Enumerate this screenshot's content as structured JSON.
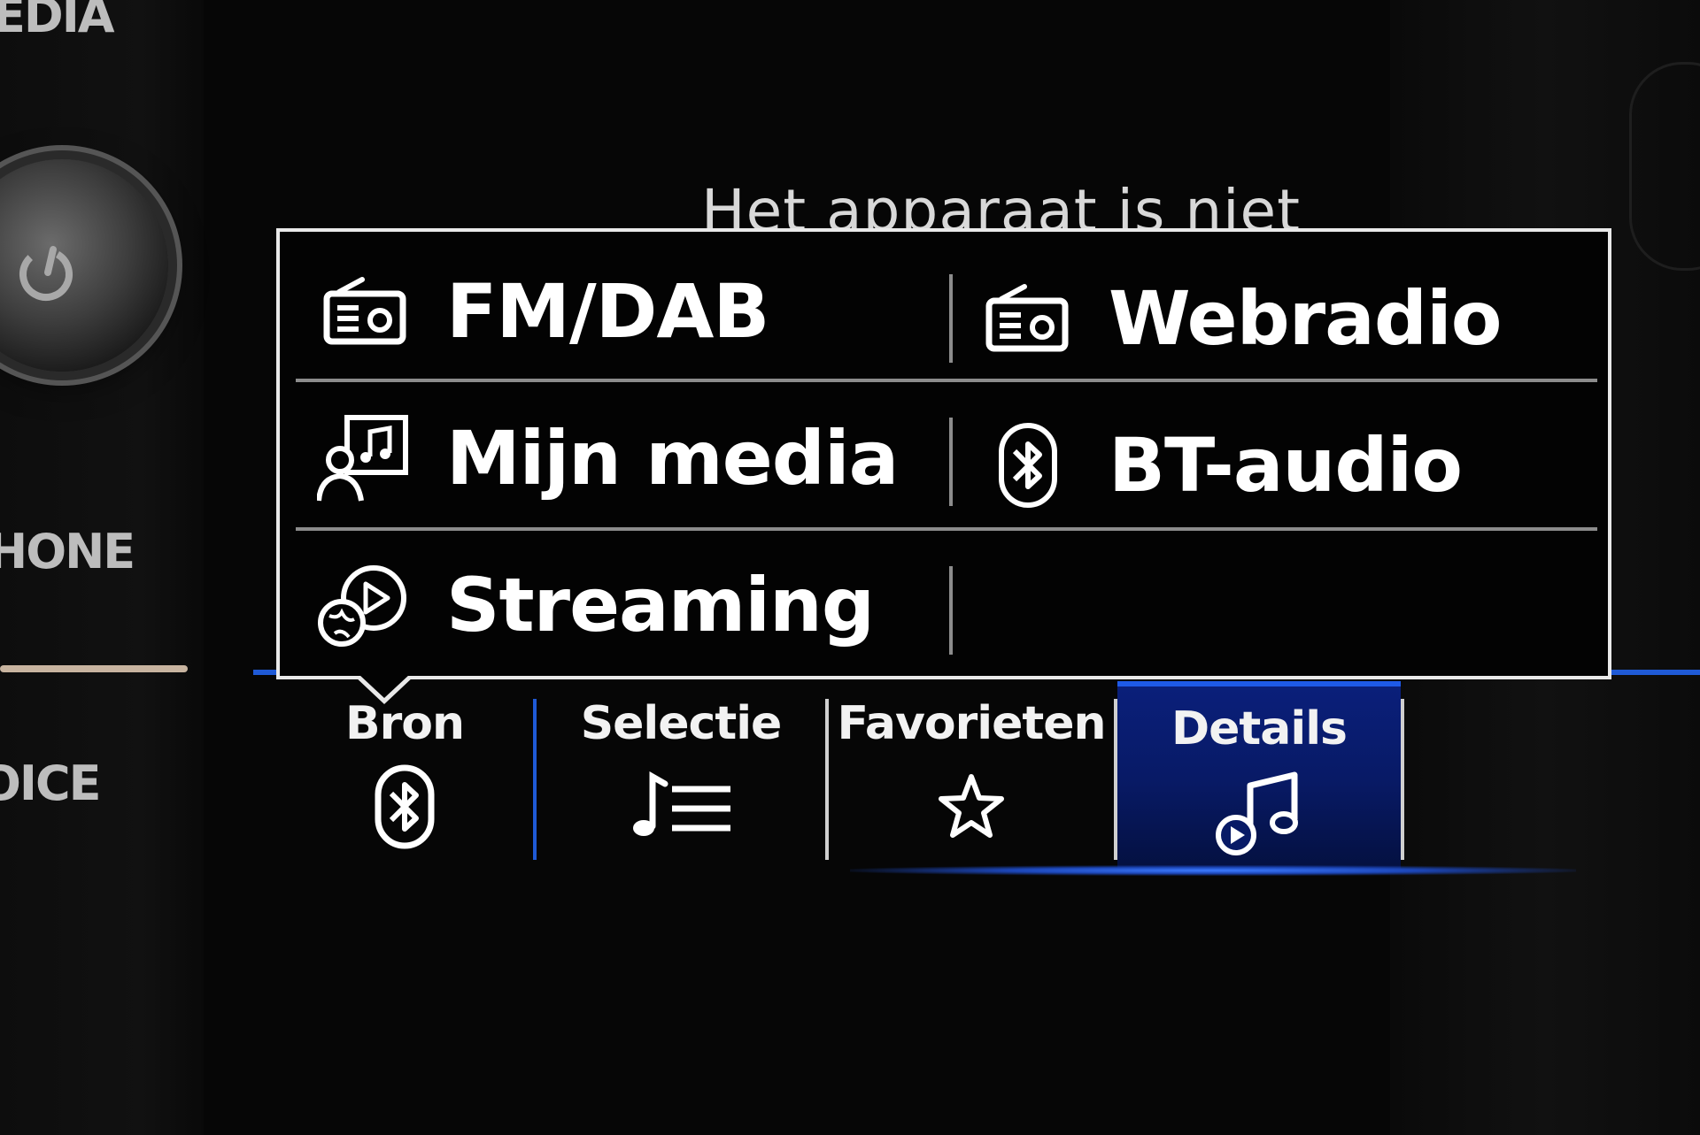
{
  "bezel": {
    "labels": {
      "media": "EDIA",
      "phone": "HONE",
      "voice": "OICE"
    }
  },
  "background_message": "Het apparaat is niet",
  "source_menu": {
    "items": [
      {
        "label": "FM/DAB",
        "icon": "radio-icon"
      },
      {
        "label": "Webradio",
        "icon": "radio-icon"
      },
      {
        "label": "Mijn media",
        "icon": "user-music-icon"
      },
      {
        "label": "BT-audio",
        "icon": "bluetooth-icon"
      },
      {
        "label": "Streaming",
        "icon": "streaming-icon"
      }
    ]
  },
  "tabs": [
    {
      "label": "Bron",
      "icon": "bluetooth-icon",
      "active": false
    },
    {
      "label": "Selectie",
      "icon": "playlist-icon",
      "active": false
    },
    {
      "label": "Favorieten",
      "icon": "star-icon",
      "active": false
    },
    {
      "label": "Details",
      "icon": "music-note-play-icon",
      "active": true
    }
  ],
  "colors": {
    "accent_blue": "#1e5ae8",
    "active_tab_bg": "#0a1f7a",
    "popup_border": "#e9e9e9",
    "background": "#060606"
  }
}
